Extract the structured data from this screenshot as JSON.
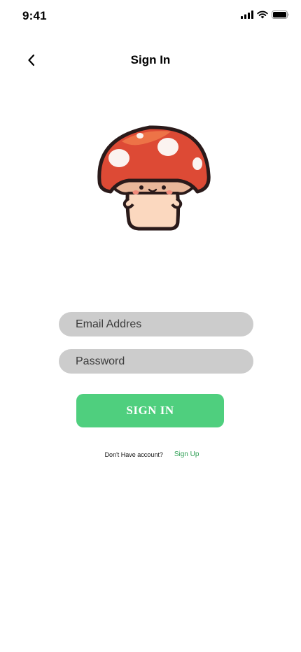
{
  "status_bar": {
    "time": "9:41"
  },
  "header": {
    "title": "Sign In",
    "back_icon": "chevron-left-icon"
  },
  "mascot": {
    "icon": "mushroom-mascot"
  },
  "form": {
    "email_placeholder": "Email Addres",
    "email_value": "",
    "password_placeholder": "Password",
    "password_value": "",
    "submit_label": "SIGN IN"
  },
  "footer": {
    "prompt": "Don't Have account?",
    "signup_label": "Sign Up"
  },
  "colors": {
    "primary_button": "#4fcf7e",
    "link": "#2c9e52",
    "input_background": "#cccccc",
    "background": "#ffffff"
  }
}
